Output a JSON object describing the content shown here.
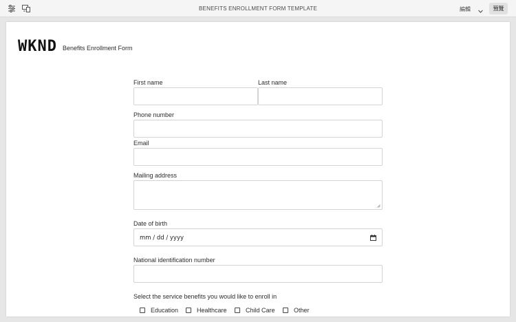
{
  "toolbar": {
    "title": "BENEFITS ENROLLMENT FORM TEMPLATE",
    "mode_label": "編輯",
    "preview_label": "預覽",
    "icons": [
      "properties-icon",
      "emulator-icon",
      "chevron-down-icon"
    ]
  },
  "header": {
    "logo_text": "WKND",
    "subtitle": "Benefits Enrollment Form"
  },
  "form": {
    "first_name": {
      "label": "First name",
      "value": ""
    },
    "last_name": {
      "label": "Last name",
      "value": ""
    },
    "phone": {
      "label": "Phone number",
      "value": ""
    },
    "email": {
      "label": "Email",
      "value": ""
    },
    "mailing_address": {
      "label": "Mailing address",
      "value": ""
    },
    "date_of_birth": {
      "label": "Date of birth",
      "placeholder": "mm / dd / yyyy"
    },
    "national_id": {
      "label": "National identification number",
      "value": ""
    },
    "benefits": {
      "label": "Select the service benefits you would like to enroll in",
      "options": [
        "Education",
        "Healthcare",
        "Child Care",
        "Other"
      ]
    }
  },
  "colors": {
    "page_background": "#e6e6e6",
    "toolbar_background": "#f5f5f5",
    "input_border": "#d3d3d3",
    "text": "#2c2c2c"
  }
}
